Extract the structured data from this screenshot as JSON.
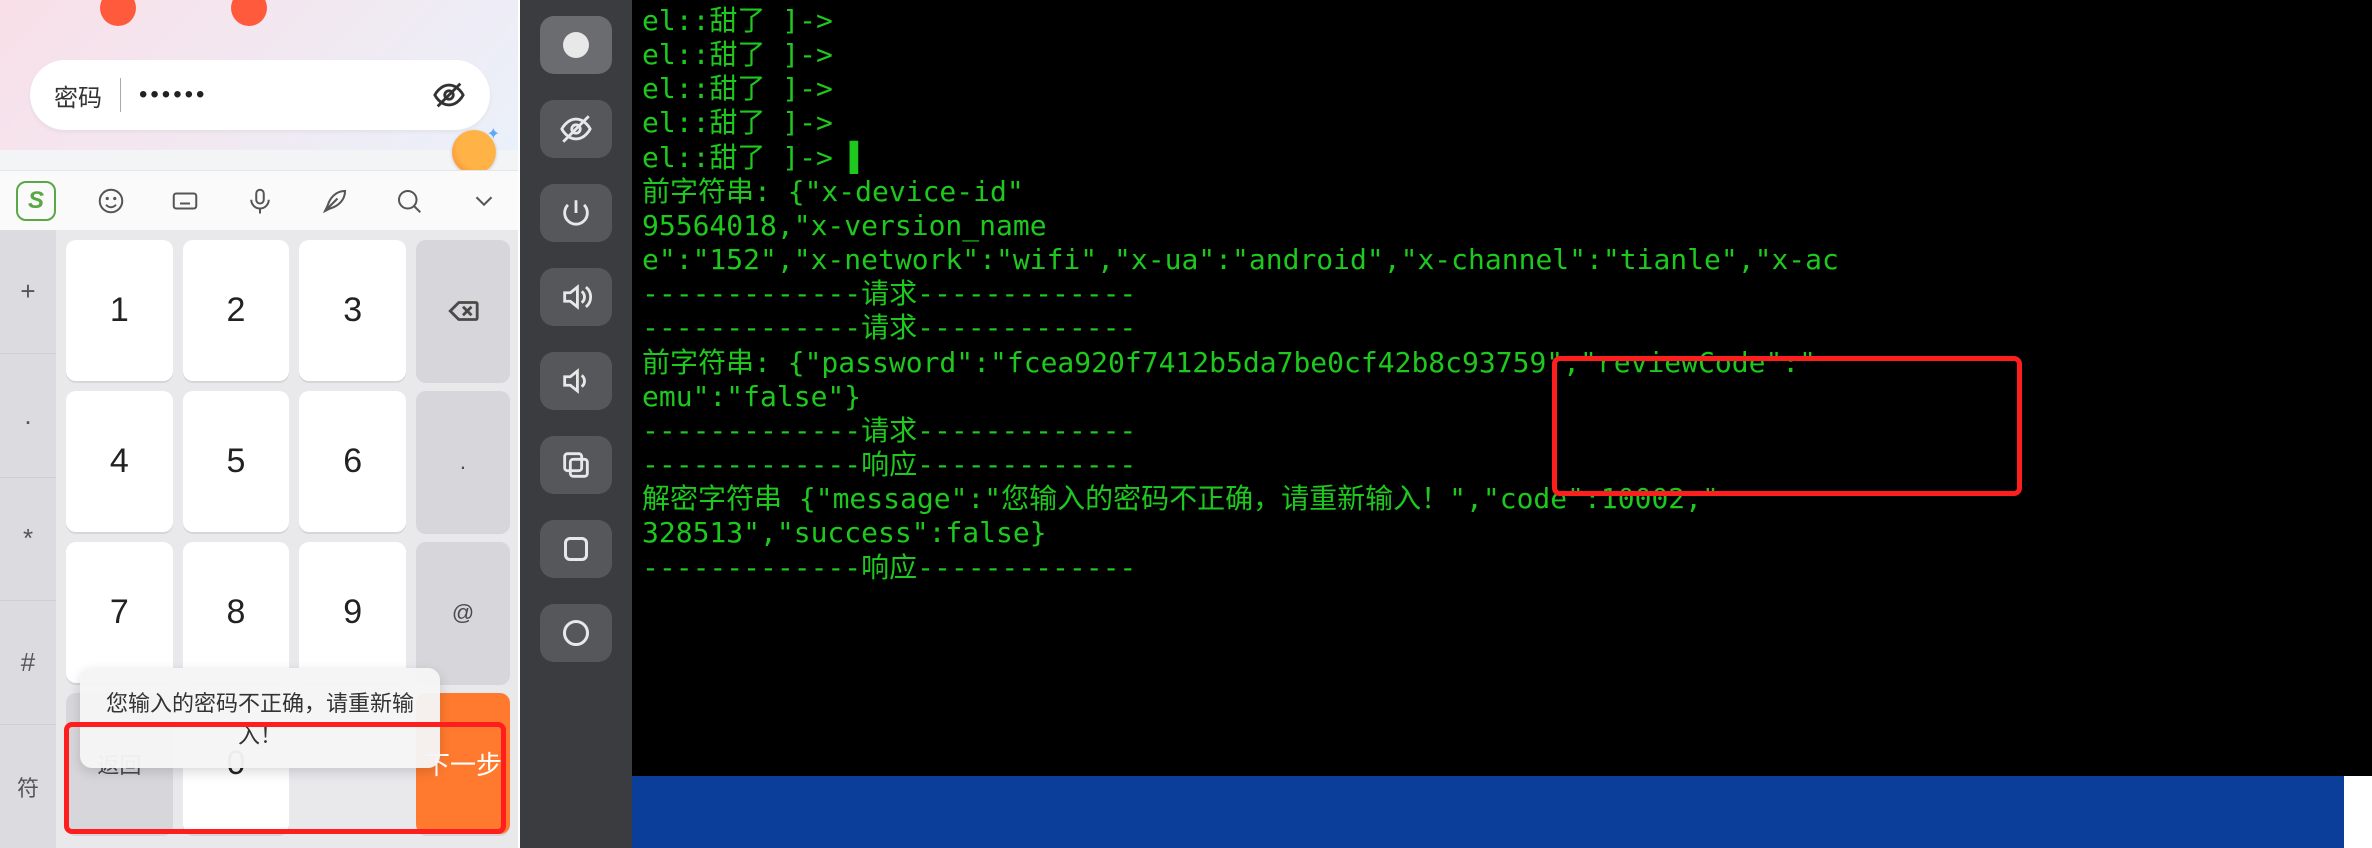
{
  "phone": {
    "password_label": "密码",
    "password_masked": "••••••",
    "ime_logo": "S",
    "symbol_col": [
      "+",
      ".",
      "*",
      "#",
      "符"
    ],
    "keys": {
      "k1": "1",
      "k2": "2",
      "k3": "3",
      "k4": "4",
      "k5": "5",
      "k6": "6",
      "k7": "7",
      "k8": "8",
      "k9": "9",
      "k0": "0",
      "at": "@",
      "dot": ".",
      "back": "返回",
      "next": "下一步"
    },
    "toast": "您输入的密码不正确，请重新输入！"
  },
  "sidebar": {
    "items": [
      {
        "name": "record-dot"
      },
      {
        "name": "visibility-off"
      },
      {
        "name": "power"
      },
      {
        "name": "volume-up"
      },
      {
        "name": "volume-down"
      },
      {
        "name": "copy"
      },
      {
        "name": "square"
      },
      {
        "name": "circle"
      }
    ]
  },
  "terminal": {
    "lines": [
      "el::甜了 ]->",
      "el::甜了 ]->",
      "el::甜了 ]->",
      "el::甜了 ]->",
      "el::甜了 ]-> ▌",
      "前字符串: {\"x-device-id\"",
      "95564018,\"x-version_name",
      "e\":\"152\",\"x-network\":\"wifi\",\"x-ua\":\"android\",\"x-channel\":\"tianle\",\"x-ac",
      "-------------请求-------------",
      "-------------请求-------------",
      "前字符串: {\"password\":\"fcea920f7412b5da7be0cf42b8c93759\",\"reviewCode\":\"",
      "emu\":\"false\"}",
      "-------------请求-------------",
      "-------------响应-------------",
      "解密字符串 {\"message\":\"您输入的密码不正确，请重新输入！\",\"code\":10002,\"",
      "328513\",\"success\":false}",
      "-------------响应-------------"
    ]
  }
}
